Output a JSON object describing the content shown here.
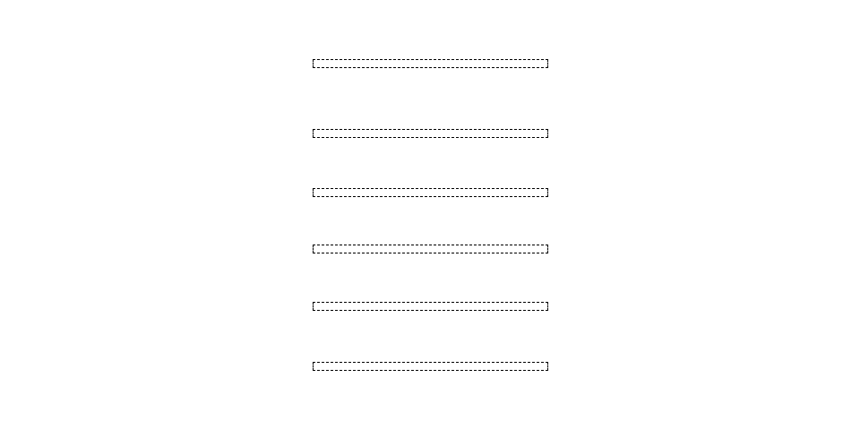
{
  "placeholders": [
    {
      "label": ""
    },
    {
      "label": ""
    },
    {
      "label": ""
    },
    {
      "label": ""
    },
    {
      "label": ""
    },
    {
      "label": ""
    }
  ]
}
